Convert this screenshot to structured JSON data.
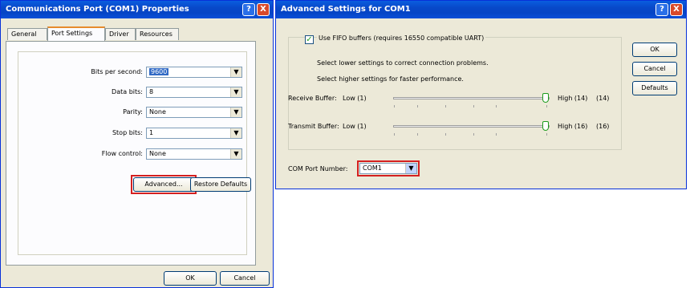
{
  "props_window": {
    "title": "Communications Port (COM1) Properties",
    "tabs": [
      "General",
      "Port Settings",
      "Driver",
      "Resources"
    ],
    "fields": [
      {
        "label": "Bits per second:",
        "value": "9600"
      },
      {
        "label": "Data bits:",
        "value": "8"
      },
      {
        "label": "Parity:",
        "value": "None"
      },
      {
        "label": "Stop bits:",
        "value": "1"
      },
      {
        "label": "Flow control:",
        "value": "None"
      }
    ],
    "advanced_label": "Advanced...",
    "restore_label": "Restore Defaults",
    "ok_label": "OK",
    "cancel_label": "Cancel"
  },
  "adv_window": {
    "title": "Advanced Settings for COM1",
    "fifo_label": "Use FIFO buffers (requires 16550 compatible UART)",
    "fifo_checked": true,
    "hint1": "Select lower settings to correct connection problems.",
    "hint2": "Select higher settings for faster performance.",
    "receive": {
      "label": "Receive Buffer:",
      "low": "Low (1)",
      "high": "High (14)",
      "value_label": "(14)",
      "fraction": 1.0
    },
    "transmit": {
      "label": "Transmit Buffer:",
      "low": "Low (1)",
      "high": "High (16)",
      "value_label": "(16)",
      "fraction": 1.0
    },
    "com_port_label": "COM Port Number:",
    "com_port_value": "COM1",
    "ok_label": "OK",
    "cancel_label": "Cancel",
    "defaults_label": "Defaults"
  },
  "titlebar_buttons": {
    "help": "?",
    "close": "X"
  },
  "colors": {
    "highlight_box": "#d42020",
    "titlebar": "#0a5ddf",
    "dialog_bg": "#ece9d8"
  }
}
